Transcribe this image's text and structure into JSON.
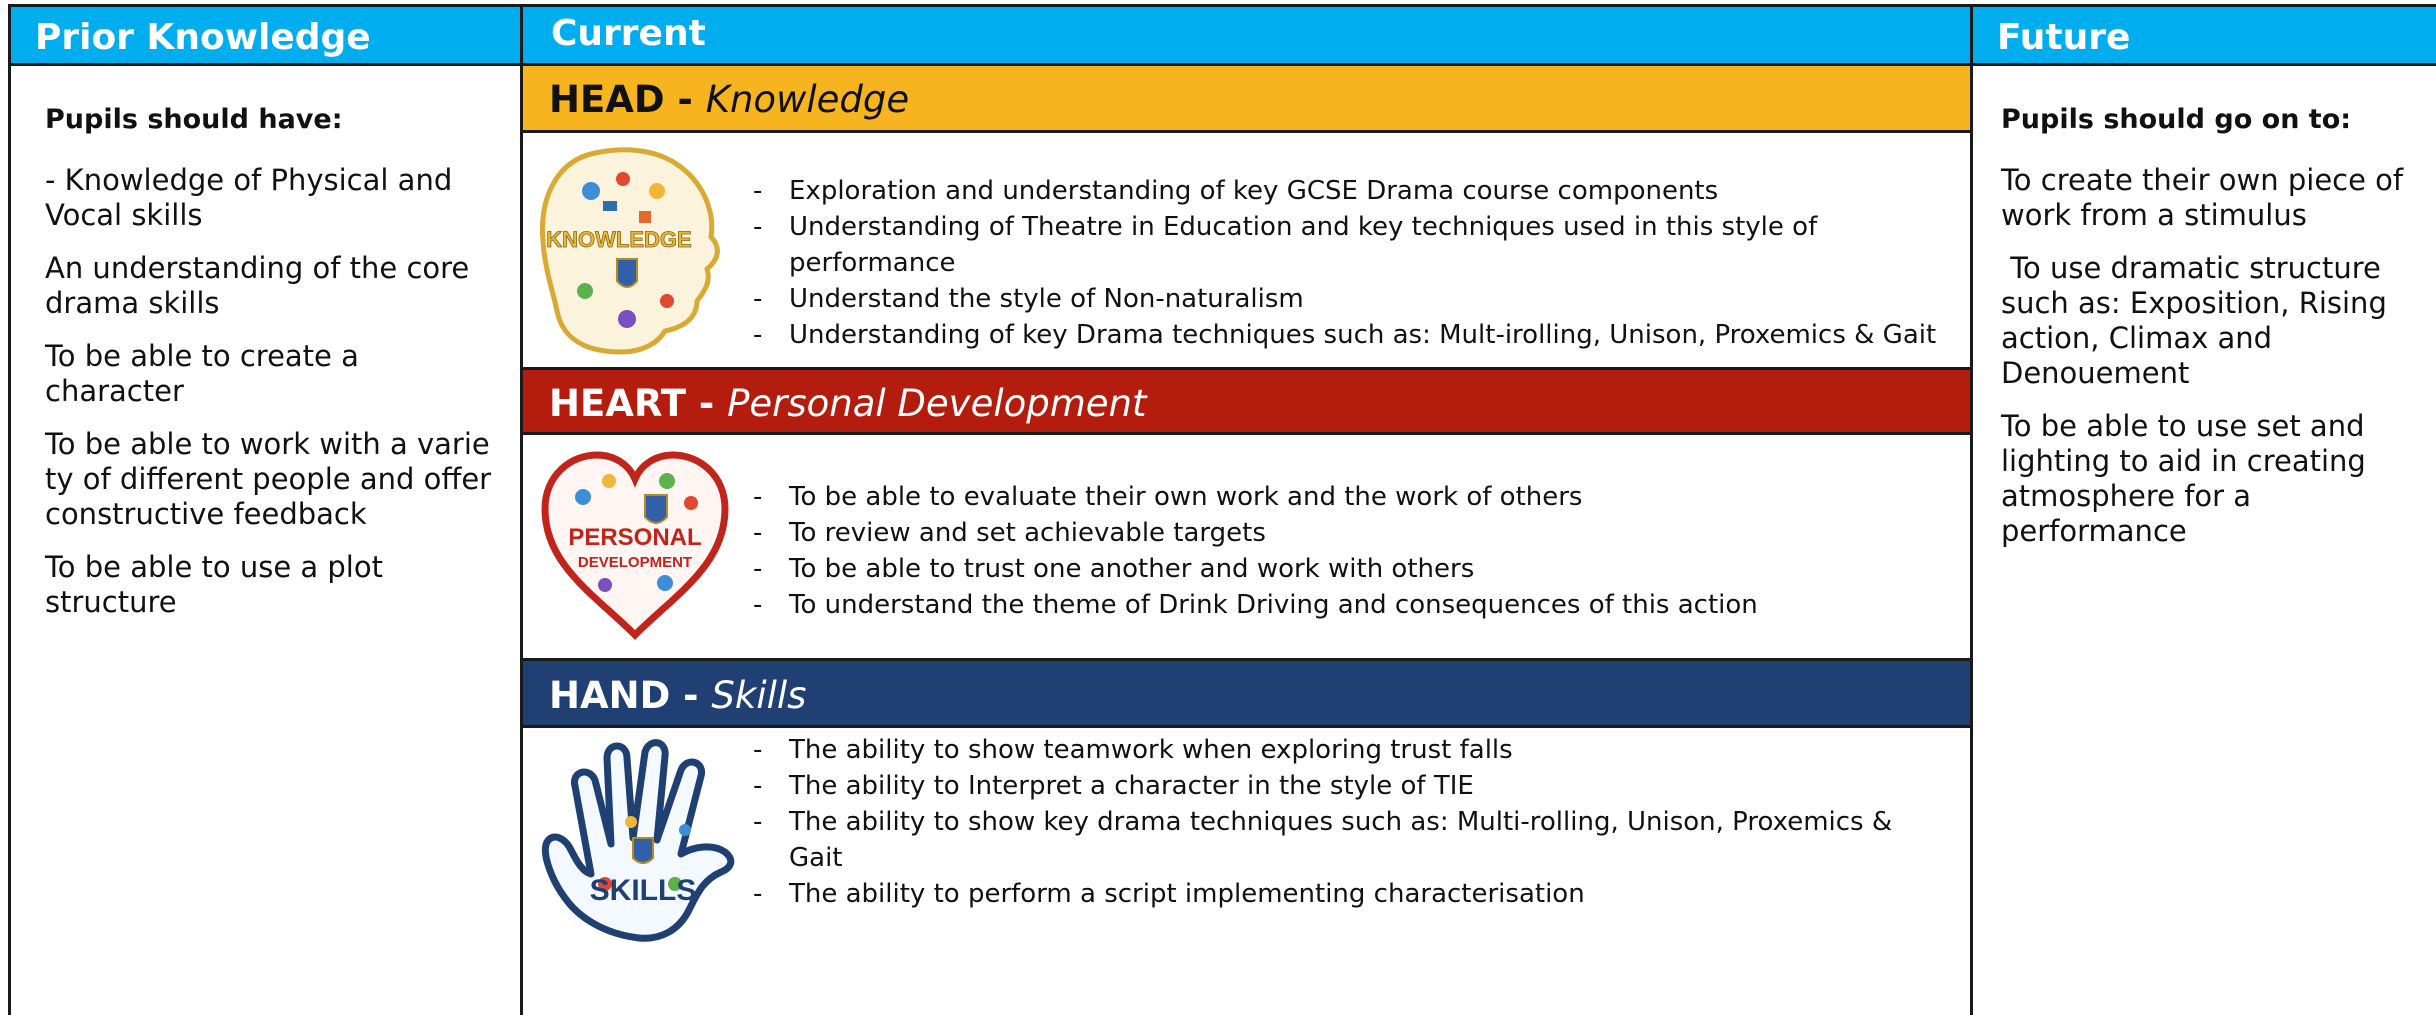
{
  "columns": {
    "prior": {
      "title": "Prior Knowledge",
      "lead": "Pupils should have:",
      "items": [
        "- Knowledge of Physical and Vocal skills",
        "An understanding of the core drama skills",
        "To be able to create a character",
        "To be able to work with a variety of different people and offer constructive feedback",
        "To be able to use a plot structure"
      ]
    },
    "current": {
      "title": "Current",
      "head": {
        "label": "HEAD - ",
        "sub": "Knowledge",
        "icon": "knowledge-head-icon",
        "icon_text": "KNOWLEDGE",
        "points": [
          "Exploration and understanding of key GCSE Drama course components",
          "Understanding of Theatre in Education and key techniques used in this style of performance",
          "Understand the style of Non-naturalism",
          "Understanding of key Drama techniques such as: Mult-irolling, Unison, Proxemics & Gait"
        ]
      },
      "heart": {
        "label": "HEART - ",
        "sub": "Personal Development",
        "icon": "personal-development-heart-icon",
        "icon_text_1": "PERSONAL",
        "icon_text_2": "DEVELOPMENT",
        "points": [
          "To be able to evaluate their own work and the work of others",
          "To review and set achievable targets",
          "To be able to trust one another and work with others",
          "To understand the theme of Drink Driving and consequences of this action"
        ]
      },
      "hand": {
        "label": "HAND - ",
        "sub": "Skills",
        "icon": "skills-hand-icon",
        "icon_text": "SKILLS",
        "points": [
          "The ability to show teamwork when exploring trust falls",
          "The ability to Interpret a character in the style of TIE",
          "The ability to show key drama techniques such as: Multi-rolling, Unison, Proxemics & Gait",
          "The ability to perform a script implementing characterisation"
        ]
      }
    },
    "future": {
      "title": "Future",
      "lead": "Pupils should go on to:",
      "items": [
        "To create their own piece of work from a stimulus",
        " To use dramatic structure such as: Exposition, Rising action, Climax and Denouement",
        "To be able to use set and lighting to aid in creating atmosphere for a performance"
      ]
    }
  },
  "colors": {
    "header_blue": "#00aef0",
    "head_yellow": "#f6b51f",
    "heart_red": "#b41c0e",
    "hand_navy": "#203f72"
  }
}
